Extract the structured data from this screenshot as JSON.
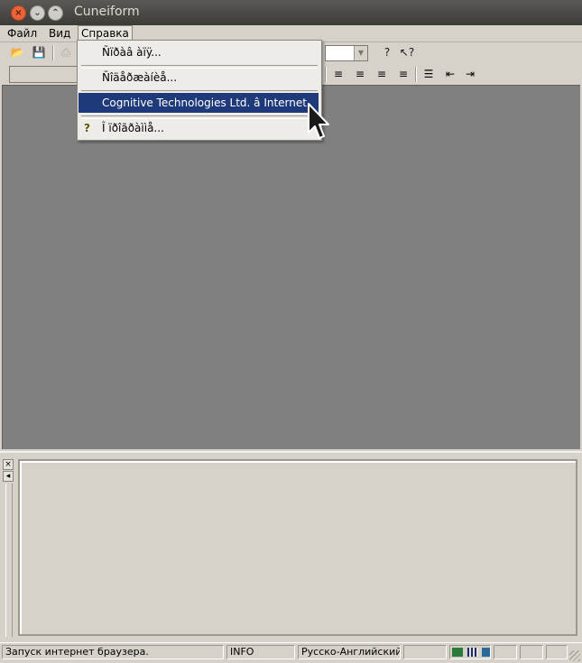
{
  "window": {
    "title": "Cuneiform"
  },
  "menubar": {
    "items": [
      {
        "label": "Файл"
      },
      {
        "label": "Вид"
      },
      {
        "label": "Справка"
      }
    ]
  },
  "dropdown": {
    "items": [
      {
        "label": "Ñïðàâ àïÿ..."
      },
      {
        "label": "Ñîäåðæàíèå..."
      },
      {
        "label": "Cognitive Technologies Ltd. â Internet"
      },
      {
        "label": "Î ïðîãðàììå..."
      }
    ]
  },
  "statusbar": {
    "message": "Запуск интернет браузера.",
    "mode": "INFO",
    "language": "Русско-Английский"
  }
}
